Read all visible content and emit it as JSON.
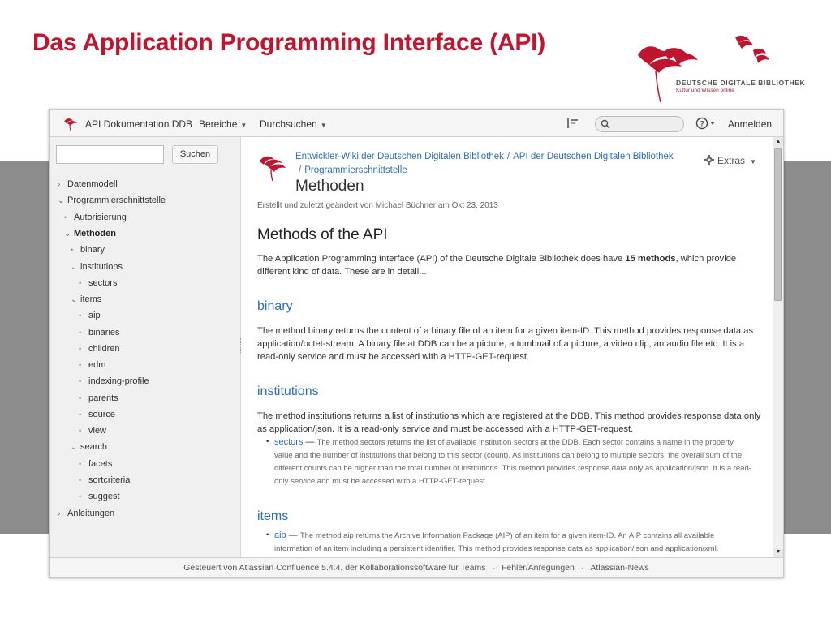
{
  "slide": {
    "title": "Das Application Programming Interface (API)",
    "logo_name": "DEUTSCHE DIGITALE BIBLIOTHEK",
    "logo_tagline": "Kultur und Wissen online",
    "title_color": "#c0152f"
  },
  "header": {
    "site_name": "API Dokumentation DDB",
    "nav": [
      "Bereiche",
      "Durchsuchen"
    ],
    "login_label": "Anmelden",
    "icons": [
      "tools-icon",
      "search-icon",
      "help-icon"
    ]
  },
  "sidebar": {
    "search_button": "Suchen",
    "search_value": "",
    "tree": [
      {
        "label": "Datenmodell",
        "marker": "›",
        "level": 0
      },
      {
        "label": "Programmierschnittstelle",
        "marker": "⌄",
        "level": 0
      },
      {
        "label": "Autorisierung",
        "marker": "•",
        "level": 1
      },
      {
        "label": "Methoden",
        "marker": "⌄",
        "level": 1,
        "bold": true
      },
      {
        "label": "binary",
        "marker": "•",
        "level": 2
      },
      {
        "label": "institutions",
        "marker": "⌄",
        "level": 2
      },
      {
        "label": "sectors",
        "marker": "•",
        "level": 3
      },
      {
        "label": "items",
        "marker": "⌄",
        "level": 2
      },
      {
        "label": "aip",
        "marker": "•",
        "level": 3
      },
      {
        "label": "binaries",
        "marker": "•",
        "level": 3
      },
      {
        "label": "children",
        "marker": "•",
        "level": 3
      },
      {
        "label": "edm",
        "marker": "•",
        "level": 3
      },
      {
        "label": "indexing-profile",
        "marker": "•",
        "level": 3
      },
      {
        "label": "parents",
        "marker": "•",
        "level": 3
      },
      {
        "label": "source",
        "marker": "•",
        "level": 3
      },
      {
        "label": "view",
        "marker": "•",
        "level": 3
      },
      {
        "label": "search",
        "marker": "⌄",
        "level": 2
      },
      {
        "label": "facets",
        "marker": "•",
        "level": 3
      },
      {
        "label": "sortcriteria",
        "marker": "•",
        "level": 3
      },
      {
        "label": "suggest",
        "marker": "•",
        "level": 3
      },
      {
        "label": "Anleitungen",
        "marker": "›",
        "level": 0
      }
    ]
  },
  "page": {
    "breadcrumbs": [
      "Entwickler-Wiki der Deutschen Digitalen Bibliothek",
      "API der Deutschen Digitalen Bibliothek",
      "Programmierschnittstelle"
    ],
    "title": "Methoden",
    "extras_label": "Extras",
    "meta": "Erstellt und zuletzt geändert von Michael Büchner am Okt 23, 2013",
    "heading": "Methods of the API",
    "intro_before": "The Application Programming Interface (API) of the Deutsche Digitale Bibliothek does have ",
    "intro_bold": "15 methods",
    "intro_after": ", which provide different kind of data. These are in detail...",
    "sections": {
      "binary": {
        "heading": "binary",
        "text": "The method binary returns the content of a binary file of an item for a given item-ID. This method provides response data as application/octet-stream. A binary file at DDB can be a picture, a tumbnail of a picture, a video clip, an audio file etc. It is a read-only service and must be accessed with a HTTP-GET-request."
      },
      "institutions": {
        "heading": "institutions",
        "text": "The method institutions returns a list of institutions which are registered at the DDB. This method provides response data only as application/json. It is a read-only service and must be accessed with a HTTP-GET-request.",
        "items": [
          {
            "link": "sectors",
            "text": "The method sectors returns the list of available institution sectors at the DDB. Each sector contains a name in the property value and the number of institutions that belong to this sector (count). As institutions can belong to multiple sectors, the overall sum of the different counts can be higher than the total number of institutions. This method provides response data only as application/json. It is a read-only service and must be accessed with a HTTP-GET-request."
          }
        ]
      },
      "items": {
        "heading": "items",
        "items": [
          {
            "link": "aip",
            "text": "The method aip returns the Archive Information Package (AIP) of an item for a given item-ID. An AIP contains all available information of an item including a persistent identifier. This method provides response data as application/json and application/xml."
          }
        ]
      }
    }
  },
  "footer": {
    "powered": "Gesteuert von Atlassian Confluence 5.4.4, der Kollaborationssoftware für Teams",
    "links": [
      "Fehler/Anregungen",
      "Atlassian-News"
    ]
  }
}
